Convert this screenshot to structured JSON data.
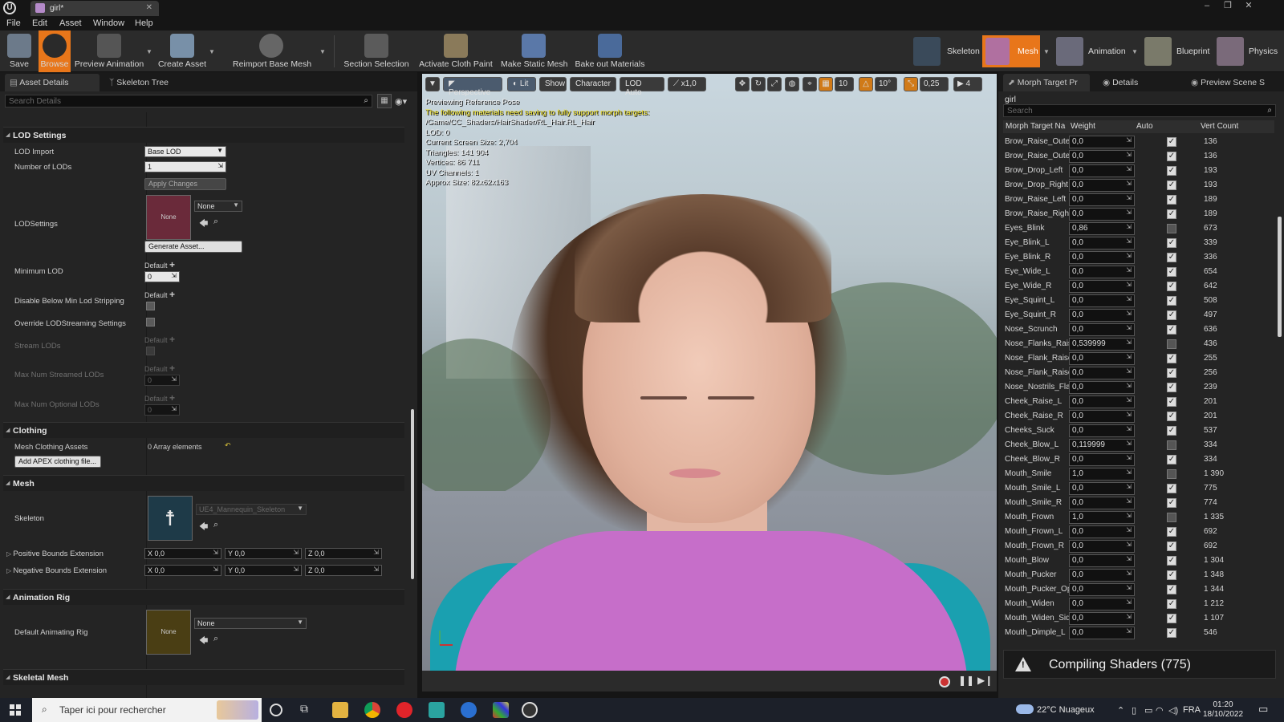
{
  "window": {
    "tab_title": "girl*"
  },
  "menu": [
    "File",
    "Edit",
    "Asset",
    "Window",
    "Help"
  ],
  "toolbar": {
    "save": "Save",
    "browse": "Browse",
    "preview_animation": "Preview Animation",
    "create_asset": "Create Asset",
    "reimport": "Reimport Base Mesh",
    "section_selection": "Section Selection",
    "activate_cloth": "Activate Cloth Paint",
    "make_static": "Make Static Mesh",
    "bake_materials": "Bake out Materials",
    "modes": {
      "skeleton": "Skeleton",
      "mesh": "Mesh",
      "animation": "Animation",
      "blueprint": "Blueprint",
      "physics": "Physics"
    }
  },
  "left": {
    "tabs": {
      "asset_details": "Asset Details",
      "skeleton_tree": "Skeleton Tree"
    },
    "search_placeholder": "Search Details",
    "lod": {
      "section": "LOD Settings",
      "lod_import_label": "LOD Import",
      "lod_import_value": "Base LOD",
      "num_lods_label": "Number of LODs",
      "num_lods_value": "1",
      "apply_changes": "Apply Changes",
      "lodsettings_label": "LODSettings",
      "thumb_none": "None",
      "lodsettings_value": "None",
      "generate_asset": "Generate Asset...",
      "min_lod_label": "Minimum LOD",
      "default": "Default",
      "min_lod_value": "0",
      "disable_label": "Disable Below Min Lod Stripping",
      "override_label": "Override LODStreaming Settings",
      "stream_label": "Stream LODs",
      "max_streamed_label": "Max Num Streamed LODs",
      "max_streamed_value": "0",
      "max_optional_label": "Max Num Optional LODs",
      "max_optional_value": "0"
    },
    "clothing": {
      "section": "Clothing",
      "assets_label": "Mesh Clothing Assets",
      "assets_value": "0 Array elements",
      "add_apex": "Add APEX clothing file..."
    },
    "mesh": {
      "section": "Mesh",
      "skeleton_label": "Skeleton",
      "skeleton_value": "UE4_Mannequin_Skeleton",
      "pos_bounds_label": "Positive Bounds Extension",
      "neg_bounds_label": "Negative Bounds Extension",
      "x": "X",
      "y": "Y",
      "z": "Z",
      "zero": "0,0"
    },
    "animation_rig": {
      "section": "Animation Rig",
      "default_rig_label": "Default Animating Rig",
      "thumb_none": "None",
      "rig_value": "None"
    },
    "skeletal_mesh": {
      "section": "Skeletal Mesh"
    }
  },
  "viewport": {
    "perspective": "Perspective",
    "lit": "Lit",
    "show": "Show",
    "character": "Character",
    "lod_auto": "LOD Auto",
    "speed": "x1,0",
    "grid": "10",
    "angle": "10°",
    "scale": "0,25",
    "cam_speed": "4",
    "overlay": {
      "line1": "Previewing Reference Pose",
      "warn1": "The following materials need saving to fully support morph targets:",
      "path": "/Game/CC_Shaders/HairShader/RL_Hair.RL_Hair",
      "lod": "LOD: 0",
      "screen": "Current Screen Size: 2,704",
      "tris": "Triangles: 141 904",
      "verts": "Vertices: 86 711",
      "uv": "UV Channels: 1",
      "size": "Approx Size: 82x62x163"
    }
  },
  "right": {
    "tabs": {
      "morph": "Morph Target Pr",
      "details": "Details",
      "preview": "Preview Scene S"
    },
    "title": "girl",
    "search_placeholder": "Search",
    "headers": {
      "name": "Morph Target Na",
      "weight": "Weight",
      "auto": "Auto",
      "vert": "Vert Count"
    },
    "rows": [
      {
        "name": "Brow_Raise_Outer",
        "weight": "0,0",
        "auto": true,
        "vert": "136"
      },
      {
        "name": "Brow_Raise_Outer",
        "weight": "0,0",
        "auto": true,
        "vert": "136"
      },
      {
        "name": "Brow_Drop_Left",
        "weight": "0,0",
        "auto": true,
        "vert": "193"
      },
      {
        "name": "Brow_Drop_Right",
        "weight": "0,0",
        "auto": true,
        "vert": "193"
      },
      {
        "name": "Brow_Raise_Left",
        "weight": "0,0",
        "auto": true,
        "vert": "189"
      },
      {
        "name": "Brow_Raise_Right",
        "weight": "0,0",
        "auto": true,
        "vert": "189"
      },
      {
        "name": "Eyes_Blink",
        "weight": "0,86",
        "auto": false,
        "vert": "673"
      },
      {
        "name": "Eye_Blink_L",
        "weight": "0,0",
        "auto": true,
        "vert": "339"
      },
      {
        "name": "Eye_Blink_R",
        "weight": "0,0",
        "auto": true,
        "vert": "336"
      },
      {
        "name": "Eye_Wide_L",
        "weight": "0,0",
        "auto": true,
        "vert": "654"
      },
      {
        "name": "Eye_Wide_R",
        "weight": "0,0",
        "auto": true,
        "vert": "642"
      },
      {
        "name": "Eye_Squint_L",
        "weight": "0,0",
        "auto": true,
        "vert": "508"
      },
      {
        "name": "Eye_Squint_R",
        "weight": "0,0",
        "auto": true,
        "vert": "497"
      },
      {
        "name": "Nose_Scrunch",
        "weight": "0,0",
        "auto": true,
        "vert": "636"
      },
      {
        "name": "Nose_Flanks_Raise",
        "weight": "0,539999",
        "auto": false,
        "vert": "436"
      },
      {
        "name": "Nose_Flank_Raise",
        "weight": "0,0",
        "auto": true,
        "vert": "255"
      },
      {
        "name": "Nose_Flank_Raise",
        "weight": "0,0",
        "auto": true,
        "vert": "256"
      },
      {
        "name": "Nose_Nostrils_Flare",
        "weight": "0,0",
        "auto": true,
        "vert": "239"
      },
      {
        "name": "Cheek_Raise_L",
        "weight": "0,0",
        "auto": true,
        "vert": "201"
      },
      {
        "name": "Cheek_Raise_R",
        "weight": "0,0",
        "auto": true,
        "vert": "201"
      },
      {
        "name": "Cheeks_Suck",
        "weight": "0,0",
        "auto": true,
        "vert": "537"
      },
      {
        "name": "Cheek_Blow_L",
        "weight": "0,119999",
        "auto": false,
        "vert": "334"
      },
      {
        "name": "Cheek_Blow_R",
        "weight": "0,0",
        "auto": true,
        "vert": "334"
      },
      {
        "name": "Mouth_Smile",
        "weight": "1,0",
        "auto": false,
        "vert": "1 390"
      },
      {
        "name": "Mouth_Smile_L",
        "weight": "0,0",
        "auto": true,
        "vert": "775"
      },
      {
        "name": "Mouth_Smile_R",
        "weight": "0,0",
        "auto": true,
        "vert": "774"
      },
      {
        "name": "Mouth_Frown",
        "weight": "1,0",
        "auto": false,
        "vert": "1 335"
      },
      {
        "name": "Mouth_Frown_L",
        "weight": "0,0",
        "auto": true,
        "vert": "692"
      },
      {
        "name": "Mouth_Frown_R",
        "weight": "0,0",
        "auto": true,
        "vert": "692"
      },
      {
        "name": "Mouth_Blow",
        "weight": "0,0",
        "auto": true,
        "vert": "1 304"
      },
      {
        "name": "Mouth_Pucker",
        "weight": "0,0",
        "auto": true,
        "vert": "1 348"
      },
      {
        "name": "Mouth_Pucker_Open",
        "weight": "0,0",
        "auto": true,
        "vert": "1 344"
      },
      {
        "name": "Mouth_Widen",
        "weight": "0,0",
        "auto": true,
        "vert": "1 212"
      },
      {
        "name": "Mouth_Widen_Sides",
        "weight": "0,0",
        "auto": true,
        "vert": "1 107"
      },
      {
        "name": "Mouth_Dimple_L",
        "weight": "0,0",
        "auto": true,
        "vert": "546"
      }
    ],
    "toast": "Compiling Shaders (775)"
  },
  "taskbar": {
    "search": "Taper ici pour rechercher",
    "weather": "22°C Nuageux",
    "lang": "FRA",
    "time": "01:20",
    "date": "18/10/2022"
  }
}
